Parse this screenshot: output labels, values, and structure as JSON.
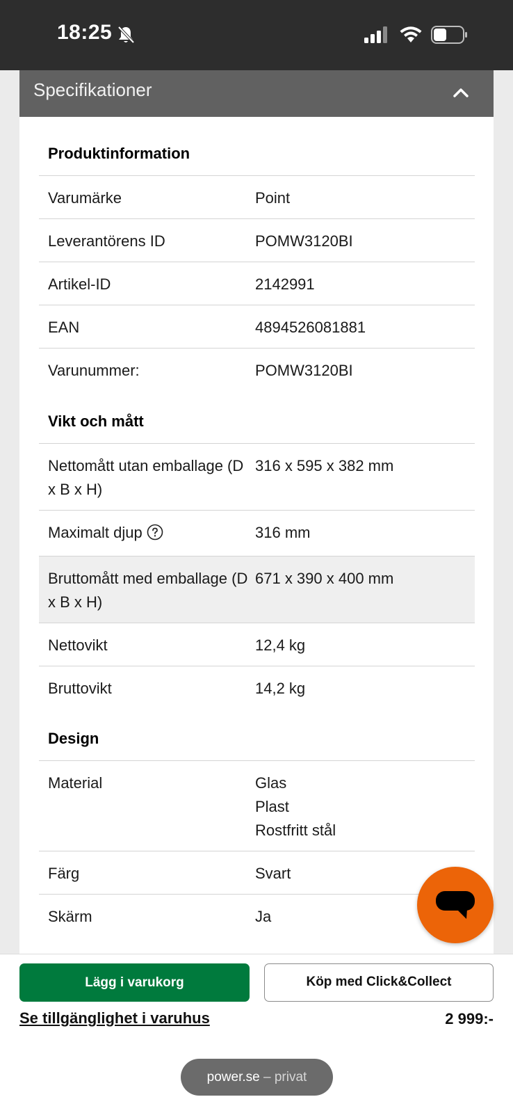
{
  "status_bar": {
    "time": "18:25"
  },
  "header": {
    "title": "Specifikationer"
  },
  "sections": [
    {
      "title": "Produktinformation",
      "rows": [
        {
          "label": "Varumärke",
          "value": "Point"
        },
        {
          "label": "Leverantörens ID",
          "value": "POMW3120BI"
        },
        {
          "label": "Artikel-ID",
          "value": "2142991"
        },
        {
          "label": "EAN",
          "value": "4894526081881"
        },
        {
          "label": "Varunummer:",
          "value": "POMW3120BI"
        }
      ]
    },
    {
      "title": "Vikt och mått",
      "rows": [
        {
          "label": "Nettomått utan emballage (D x B x H)",
          "value": "316 x 595 x 382 mm"
        },
        {
          "label": "Maximalt djup",
          "value": "316 mm"
        },
        {
          "label": "Bruttomått med emballage (D x B x H)",
          "value": "671 x 390 x 400 mm"
        },
        {
          "label": "Nettovikt",
          "value": "12,4 kg"
        },
        {
          "label": "Bruttovikt",
          "value": "14,2 kg"
        }
      ]
    },
    {
      "title": "Design",
      "rows": [
        {
          "label": "Material",
          "value_lines": [
            "Glas",
            "Plast",
            "Rostfritt stål"
          ]
        },
        {
          "label": "Färg",
          "value": "Svart"
        },
        {
          "label": "Skärm",
          "value": "Ja"
        }
      ]
    }
  ],
  "bottom_bar": {
    "add_to_cart": "Lägg i varukorg",
    "click_collect": "Köp med Click&Collect",
    "store_link": "Se tillgänglighet i varuhus",
    "price": "2 999:-"
  },
  "browser": {
    "domain": "power.se",
    "mode": "– privat"
  },
  "colors": {
    "header_bg": "#616161",
    "primary_green": "#007a3d",
    "chat_orange": "#ec6408",
    "status_bar_bg": "#2d2d2d"
  }
}
